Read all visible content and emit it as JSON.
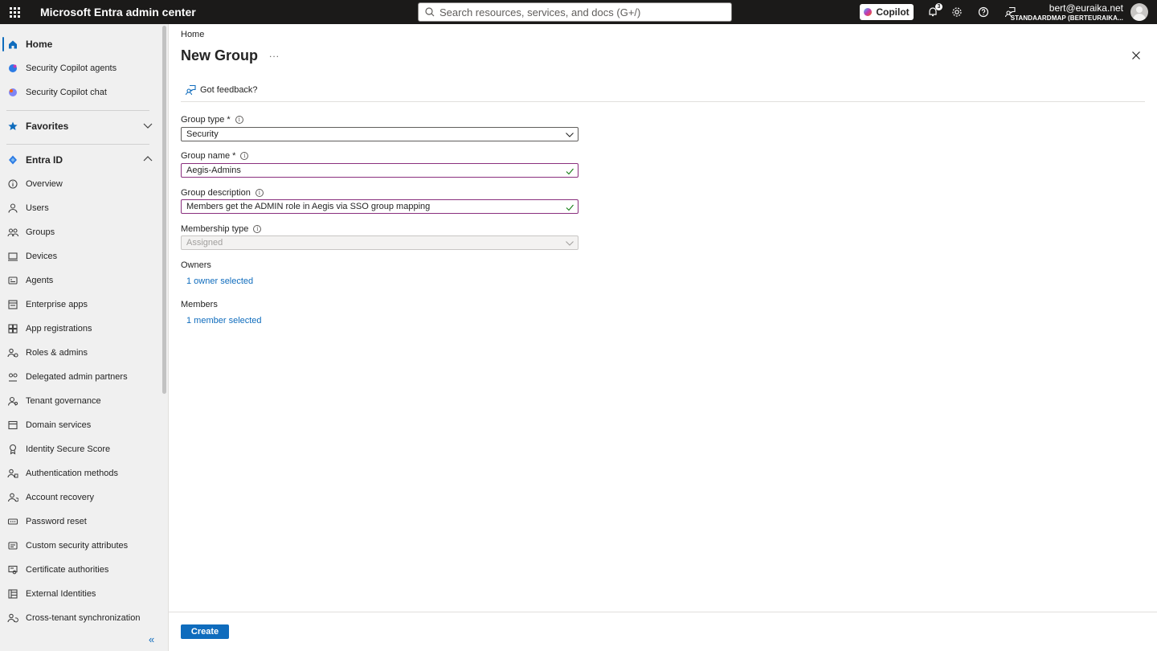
{
  "topbar": {
    "app_title": "Microsoft Entra admin center",
    "search_placeholder": "Search resources, services, and docs (G+/)",
    "copilot_label": "Copilot",
    "notification_count": "3",
    "account_email": "bert@euraika.net",
    "account_tenant": "STANDAARDMAP (BERTEURAIKA..."
  },
  "sidebar": {
    "home": "Home",
    "security_copilot_agents": "Security Copilot agents",
    "security_copilot_chat": "Security Copilot chat",
    "favorites": "Favorites",
    "entra_id": "Entra ID",
    "items": [
      {
        "label": "Overview",
        "icon": "info-icon"
      },
      {
        "label": "Users",
        "icon": "user-icon"
      },
      {
        "label": "Groups",
        "icon": "groups-icon"
      },
      {
        "label": "Devices",
        "icon": "devices-icon"
      },
      {
        "label": "Agents",
        "icon": "agents-icon"
      },
      {
        "label": "Enterprise apps",
        "icon": "enterprise-apps-icon"
      },
      {
        "label": "App registrations",
        "icon": "app-registrations-icon"
      },
      {
        "label": "Roles & admins",
        "icon": "roles-icon"
      },
      {
        "label": "Delegated admin partners",
        "icon": "delegated-admin-icon"
      },
      {
        "label": "Tenant governance",
        "icon": "tenant-governance-icon"
      },
      {
        "label": "Domain services",
        "icon": "domain-services-icon"
      },
      {
        "label": "Identity Secure Score",
        "icon": "secure-score-icon"
      },
      {
        "label": "Authentication methods",
        "icon": "auth-methods-icon"
      },
      {
        "label": "Account recovery",
        "icon": "account-recovery-icon"
      },
      {
        "label": "Password reset",
        "icon": "password-reset-icon"
      },
      {
        "label": "Custom security attributes",
        "icon": "custom-attributes-icon"
      },
      {
        "label": "Certificate authorities",
        "icon": "certificate-icon"
      },
      {
        "label": "External Identities",
        "icon": "external-identities-icon"
      },
      {
        "label": "Cross-tenant synchronization",
        "icon": "cross-tenant-sync-icon"
      }
    ],
    "collapse_glyph": "«"
  },
  "main": {
    "breadcrumb": "Home",
    "title": "New Group",
    "more": "...",
    "feedback": "Got feedback?",
    "group_type_label": "Group type",
    "group_type_value": "Security",
    "group_name_label": "Group name",
    "group_name_value": "Aegis-Admins",
    "group_description_label": "Group description",
    "group_description_value": "Members get the ADMIN role in Aegis via SSO group mapping",
    "membership_type_label": "Membership type",
    "membership_type_value": "Assigned",
    "owners_label": "Owners",
    "owners_link": "1 owner selected",
    "members_label": "Members",
    "members_link": "1 member selected",
    "required_mark": "*",
    "create_label": "Create"
  },
  "colors": {
    "accent": "#0f6cbd",
    "topbar_bg": "#1b1a19",
    "sidebar_bg": "#f0f0f0"
  }
}
